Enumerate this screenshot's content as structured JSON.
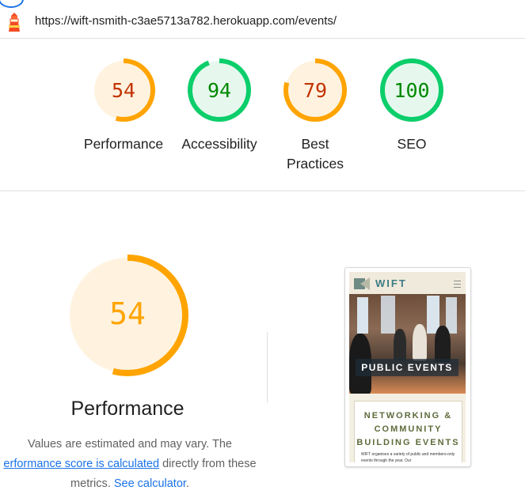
{
  "url": "https://wift-nsmith-c3ae5713a782.herokuapp.com/events/",
  "colors": {
    "orange": "#ffa400",
    "orange_text": "#c33300",
    "orange_bg": "#fff3e0",
    "green": "#0cce6b",
    "green_text": "#008800",
    "green_bg": "#e6f8ee",
    "link": "#1a73e8"
  },
  "gauges": [
    {
      "score": 54,
      "label": "Performance",
      "status": "average"
    },
    {
      "score": 94,
      "label": "Accessibility",
      "status": "pass"
    },
    {
      "score": 79,
      "label_line1": "Best",
      "label_line2": "Practices",
      "status": "average"
    },
    {
      "score": 100,
      "label": "SEO",
      "status": "pass"
    }
  ],
  "performance": {
    "score": 54,
    "title": "Performance",
    "desc_prefix": "Values are estimated and may vary. The",
    "desc_link1": "erformance score is calculated",
    "desc_mid": " directly from these",
    "desc_line3": "metrics. ",
    "desc_link2": "See calculator",
    "desc_end": "."
  },
  "screenshot": {
    "logo_text": "WIFT",
    "menu_icon": "hamburger-icon",
    "hero_title": "PUBLIC EVENTS",
    "card_title_line1": "NETWORKING &",
    "card_title_line2": "COMMUNITY",
    "card_title_line3": "BUILDING EVENTS",
    "card_text": "WIFT organises a variety of public and members-only events through the year. Our"
  },
  "icons": {
    "lighthouse": "lighthouse-icon"
  }
}
